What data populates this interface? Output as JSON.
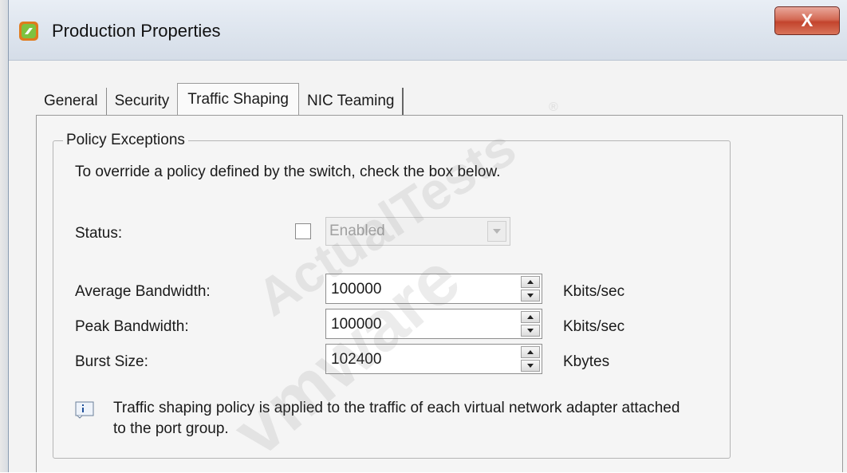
{
  "window": {
    "title": "Production Properties",
    "close_label": "X"
  },
  "tabs": [
    {
      "label": "General",
      "active": false
    },
    {
      "label": "Security",
      "active": false
    },
    {
      "label": "Traffic Shaping",
      "active": true
    },
    {
      "label": "NIC Teaming",
      "active": false
    }
  ],
  "policy": {
    "group_title": "Policy Exceptions",
    "instruction": "To override a policy defined by the switch, check the box below.",
    "status_label": "Status:",
    "status_checked": false,
    "status_value": "Enabled",
    "fields": [
      {
        "label": "Average Bandwidth:",
        "value": "100000",
        "unit": "Kbits/sec"
      },
      {
        "label": "Peak Bandwidth:",
        "value": "100000",
        "unit": "Kbits/sec"
      },
      {
        "label": "Burst Size:",
        "value": "102400",
        "unit": "Kbytes"
      }
    ],
    "info_line1": "Traffic shaping policy is applied to the traffic of each virtual network adapter attached",
    "info_line2": "to the port group."
  },
  "watermark": {
    "text1": "ActualTests",
    "text2": "vmware",
    "mark": "®"
  },
  "colors": {
    "titlebar": "#dfe6ef",
    "close_button": "#c3442d",
    "panel": "#f5f5f5"
  }
}
